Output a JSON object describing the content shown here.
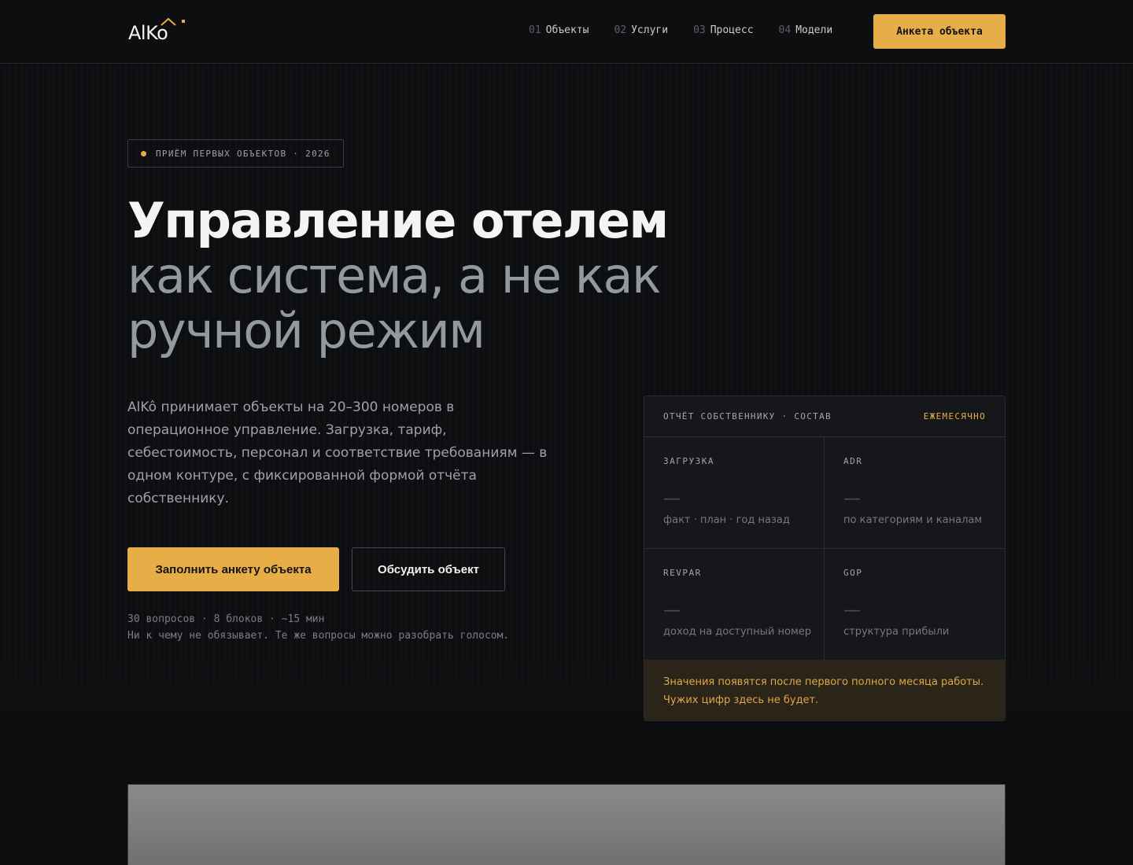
{
  "brand": {
    "logo_text": "AlKo"
  },
  "nav": {
    "items": [
      {
        "num": "01",
        "label": "Объекты"
      },
      {
        "num": "02",
        "label": "Услуги"
      },
      {
        "num": "03",
        "label": "Процесс"
      },
      {
        "num": "04",
        "label": "Модели"
      }
    ],
    "cta_label": "Анкета объекта"
  },
  "hero": {
    "badge": "ПРИЁМ ПЕРВЫХ ОБЪЕКТОВ · 2026",
    "title_strong": "Управление отелем",
    "title_rest": "как система, а не как ручной режим",
    "lead": "AlKô принимает объекты на 20–300 номеров в операционное управление. Загрузка, тариф, себестоимость, персонал и соответствие требованиям — в одном контуре, с фиксированной формой отчёта собственнику.",
    "primary_button": "Заполнить анкету объекта",
    "secondary_button": "Обсудить объект",
    "meta_line1": "30 вопросов · 8 блоков · ~15 мин",
    "meta_line2": "Ни к чему не обязывает. Те же вопросы можно разобрать голосом."
  },
  "report": {
    "title": "ОТЧЁТ СОБСТВЕННИКУ · СОСТАВ",
    "frequency": "ЕЖЕМЕСЯЧНО",
    "metrics": [
      {
        "label": "ЗАГРУЗКА",
        "value": "—",
        "desc": "факт · план · год назад"
      },
      {
        "label": "ADR",
        "value": "—",
        "desc": "по категориям и каналам"
      },
      {
        "label": "REVPAR",
        "value": "—",
        "desc": "доход на доступный номер"
      },
      {
        "label": "GOP",
        "value": "—",
        "desc": "структура прибыли"
      }
    ],
    "note_line1": "Значения появятся после первого полного месяца работы.",
    "note_line2": "Чужих цифр здесь не будет."
  },
  "colors": {
    "accent": "#e7ad47",
    "background": "#0c0d0f",
    "card": "#15171a"
  }
}
